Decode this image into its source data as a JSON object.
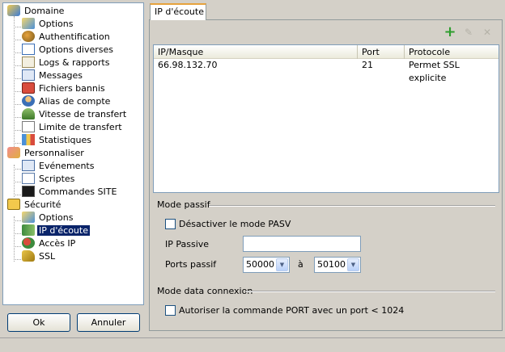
{
  "tree": {
    "items": [
      {
        "label": "Domaine",
        "icon": "domain-icon",
        "level": 0
      },
      {
        "label": "Options",
        "icon": "options-icon",
        "level": 1
      },
      {
        "label": "Authentification",
        "icon": "auth-icon",
        "level": 1
      },
      {
        "label": "Options diverses",
        "icon": "misc-options-icon",
        "level": 1
      },
      {
        "label": "Logs & rapports",
        "icon": "logs-icon",
        "level": 1
      },
      {
        "label": "Messages",
        "icon": "messages-icon",
        "level": 1
      },
      {
        "label": "Fichiers bannis",
        "icon": "banned-files-icon",
        "level": 1
      },
      {
        "label": "Alias de compte",
        "icon": "account-alias-icon",
        "level": 1
      },
      {
        "label": "Vitesse de transfert",
        "icon": "transfer-speed-icon",
        "level": 1
      },
      {
        "label": "Limite de transfert",
        "icon": "transfer-limit-icon",
        "level": 1
      },
      {
        "label": "Statistiques",
        "icon": "statistics-icon",
        "level": 1
      },
      {
        "label": "Personnaliser",
        "icon": "customize-icon",
        "level": 0
      },
      {
        "label": "Evénements",
        "icon": "events-icon",
        "level": 1
      },
      {
        "label": "Scriptes",
        "icon": "scripts-icon",
        "level": 1
      },
      {
        "label": "Commandes SITE",
        "icon": "site-commands-icon",
        "level": 1
      },
      {
        "label": "Sécurité",
        "icon": "security-icon",
        "level": 0
      },
      {
        "label": "Options",
        "icon": "security-options-icon",
        "level": 1
      },
      {
        "label": "IP d'écoute",
        "icon": "listen-ip-icon",
        "level": 1,
        "selected": true
      },
      {
        "label": "Accès IP",
        "icon": "ip-access-icon",
        "level": 1
      },
      {
        "label": "SSL",
        "icon": "ssl-key-icon",
        "level": 1
      }
    ]
  },
  "buttons": {
    "ok": "Ok",
    "cancel": "Annuler"
  },
  "tab": {
    "label": "IP d'écoute"
  },
  "toolbar": {
    "add_icon": "plus-icon",
    "edit_icon": "pencil-icon",
    "delete_icon": "x-icon",
    "add_color": "#2e9e2e"
  },
  "listview": {
    "columns": [
      "IP/Masque",
      "Port",
      "Protocole"
    ],
    "rows": [
      {
        "ip": "66.98.132.70",
        "port": "21",
        "protocol": "Permet SSL explicite"
      }
    ]
  },
  "passive": {
    "title": "Mode passif",
    "disable_label": "Désactiver le mode PASV",
    "disable_checked": false,
    "ip_label": "IP Passive",
    "ip_value": "",
    "ports_label": "Ports passif",
    "port_from": "50000",
    "to_label": "à",
    "port_to": "50100"
  },
  "dataconn": {
    "title": "Mode data connexion",
    "port_label": "Autoriser la commande PORT avec un port < 1024",
    "port_checked": false
  },
  "colors": {
    "selection": "#0a246a",
    "window_bg": "#d4d0c8",
    "tab_accent": "#e6a23c"
  }
}
